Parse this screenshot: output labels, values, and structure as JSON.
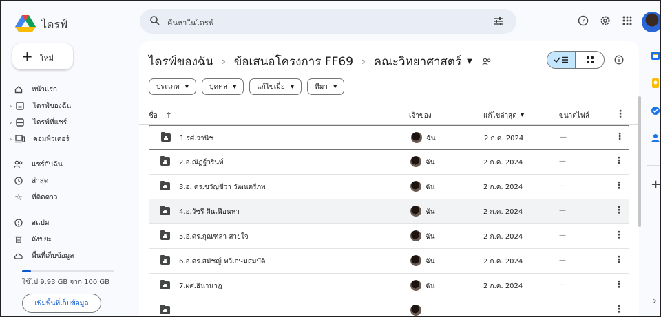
{
  "app": {
    "name": "ไดรฟ์"
  },
  "search": {
    "placeholder": "ค้นหาในไดรฟ์"
  },
  "new_button": {
    "label": "ใหม่"
  },
  "nav": {
    "home": "หน้าแรก",
    "my_drive": "ไดรฟ์ของฉัน",
    "shared_drives": "ไดรฟ์ที่แชร์",
    "computers": "คอมพิวเตอร์",
    "shared_with_me": "แชร์กับฉัน",
    "recent": "ล่าสุด",
    "starred": "ที่ติดดาว",
    "spam": "สแปม",
    "trash": "ถังขยะ",
    "storage": "พื้นที่เก็บข้อมูล"
  },
  "storage": {
    "used_text": "ใช้ไป 9.93 GB จาก 100 GB",
    "used_fraction": 0.0993,
    "button": "เพิ่มพื้นที่เก็บข้อมูล"
  },
  "breadcrumb": {
    "root": "ไดรฟ์ของฉัน",
    "parent": "ข้อเสนอโครงการ FF69",
    "current": "คณะวิทยาศาสตร์"
  },
  "filters": [
    "ประเภท",
    "บุคคล",
    "แก้ไขเมื่อ",
    "ทีมา"
  ],
  "columns": {
    "name": "ชื่อ",
    "owner": "เจ้าของ",
    "modified": "แก้ไขล่าสุด",
    "size": "ขนาดไฟล์"
  },
  "rows": [
    {
      "name": "1.รศ.วานิช",
      "owner": "ฉัน",
      "modified": "2 ก.ค. 2024",
      "size": "—"
    },
    {
      "name": "2.อ.ณัฏฐ์วรินท์",
      "owner": "ฉัน",
      "modified": "2 ก.ค. 2024",
      "size": "—"
    },
    {
      "name": "3.อ. ดร.ขวัญชีวา วัฒนตรีภพ",
      "owner": "ฉัน",
      "modified": "2 ก.ค. 2024",
      "size": "—"
    },
    {
      "name": "4.อ.วัชรี ฝันเฟือนหา",
      "owner": "ฉัน",
      "modified": "2 ก.ค. 2024",
      "size": "—"
    },
    {
      "name": "5.อ.ดร.กุณฑลา สายใจ",
      "owner": "ฉัน",
      "modified": "2 ก.ค. 2024",
      "size": "—"
    },
    {
      "name": "6.อ.ดร.สมัชญ์ ทวีเกษมสมบัติ",
      "owner": "ฉัน",
      "modified": "2 ก.ค. 2024",
      "size": "—"
    },
    {
      "name": "7.ผศ.ธินานาฎ",
      "owner": "ฉัน",
      "modified": "2 ก.ค. 2024",
      "size": "—"
    },
    {
      "name": "",
      "owner": "",
      "modified": "",
      "size": ""
    }
  ],
  "colors": {
    "accent": "#0b57d0",
    "selected_view": "#c2e7ff",
    "search_bg": "#e9eef6",
    "page_bg": "#f8fafd"
  },
  "icons": [
    "drive-logo",
    "search-icon",
    "filter-icon",
    "help-icon",
    "settings-icon",
    "apps-icon",
    "folder-icon",
    "more-vert-icon",
    "list-view-icon",
    "grid-view-icon",
    "info-icon",
    "people-icon"
  ]
}
